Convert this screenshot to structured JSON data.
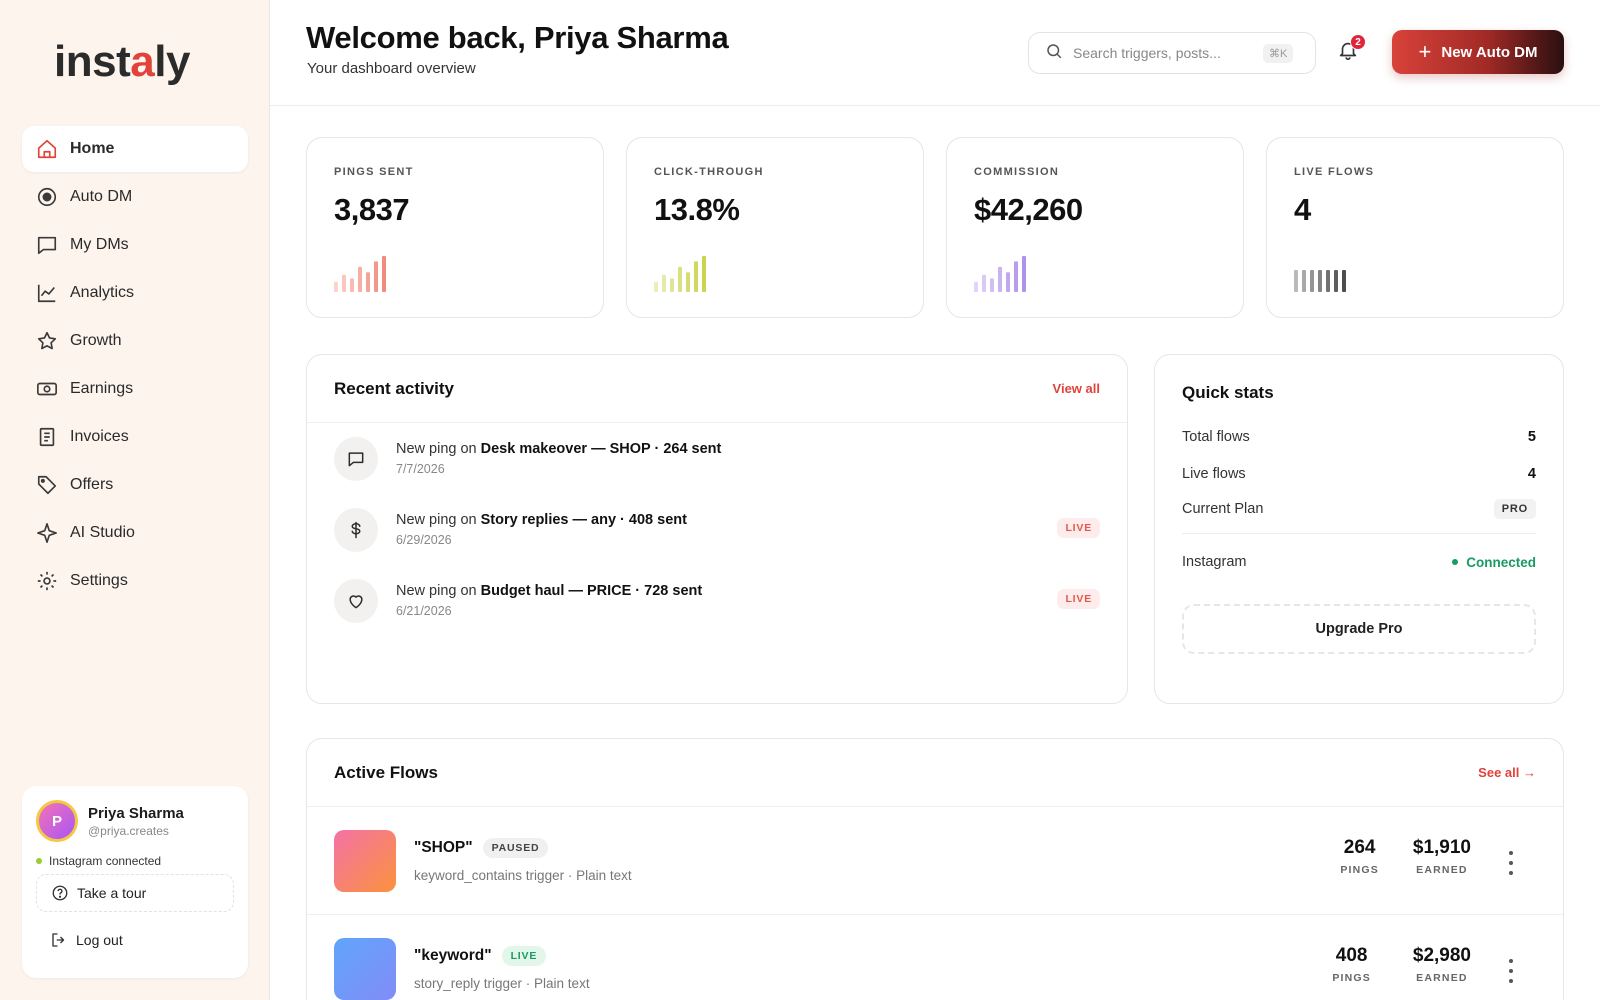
{
  "brand": {
    "logo_pre": "inst",
    "logo_dot": "a",
    "logo_post": "ly",
    "accent": "#e0433a"
  },
  "sidebar": {
    "items": [
      {
        "label": "Home",
        "icon": "home-icon",
        "active": true
      },
      {
        "label": "Auto DM",
        "icon": "radio-target-icon"
      },
      {
        "label": "My DMs",
        "icon": "message-square-icon"
      },
      {
        "label": "Analytics",
        "icon": "line-chart-icon"
      },
      {
        "label": "Growth",
        "icon": "star-icon"
      },
      {
        "label": "Earnings",
        "icon": "banknote-icon"
      },
      {
        "label": "Invoices",
        "icon": "receipt-icon"
      },
      {
        "label": "Offers",
        "icon": "tag-icon"
      },
      {
        "label": "AI Studio",
        "icon": "sparkle-icon"
      },
      {
        "label": "Settings",
        "icon": "gear-icon"
      }
    ],
    "user": {
      "initial": "P",
      "name": "Priya Sharma",
      "handle": "@priya.creates",
      "ig_status": "Instagram connected",
      "tour_label": "Take a tour",
      "logout_label": "Log out"
    }
  },
  "header": {
    "title": "Welcome back, Priya Sharma",
    "subtitle": "Your dashboard overview",
    "search_placeholder": "Search triggers, posts...",
    "search_shortcut": "⌘K",
    "notifications_count": "2",
    "new_button_label": "New Auto DM"
  },
  "stats": [
    {
      "label": "PINGS SENT",
      "value": "3,837",
      "color": "#f08070"
    },
    {
      "label": "CLICK-THROUGH",
      "value": "13.8%",
      "color": "#c5cf3a"
    },
    {
      "label": "COMMISSION",
      "value": "$42,260",
      "color": "#a987e8"
    },
    {
      "label": "LIVE FLOWS",
      "value": "4",
      "color": "#3a3a3a"
    }
  ],
  "recent": {
    "title": "Recent activity",
    "view_all": "View all",
    "items": [
      {
        "prefix": "New ping on ",
        "name": "Desk makeover — SHOP · 264 sent",
        "date": "7/7/2026",
        "icon": "message-icon",
        "badge": ""
      },
      {
        "prefix": "New ping on ",
        "name": "Story replies — any · 408 sent",
        "date": "6/29/2026",
        "icon": "dollar-icon",
        "badge": "LIVE"
      },
      {
        "prefix": "New ping on ",
        "name": "Budget haul — PRICE · 728 sent",
        "date": "6/21/2026",
        "icon": "heart-icon",
        "badge": "LIVE"
      }
    ]
  },
  "quick": {
    "title": "Quick stats",
    "total_flows_label": "Total flows",
    "total_flows_value": "5",
    "live_flows_label": "Live flows",
    "live_flows_value": "4",
    "plan_label": "Current Plan",
    "plan_value": "PRO",
    "instagram_label": "Instagram",
    "instagram_value": "Connected",
    "upgrade_label": "Upgrade Pro"
  },
  "flows": {
    "title": "Active Flows",
    "see_all": "See all",
    "items": [
      {
        "name": "\"SHOP\"",
        "status": "PAUSED",
        "meta": "keyword_contains trigger · Plain text",
        "pings": "264",
        "pings_label": "PINGS",
        "earned": "$1,910",
        "earned_label": "EARNED",
        "gradient": [
          "#f472a6",
          "#fb923c"
        ]
      },
      {
        "name": "\"keyword\"",
        "status": "LIVE",
        "meta": "story_reply trigger · Plain text",
        "pings": "408",
        "pings_label": "PINGS",
        "earned": "$2,980",
        "earned_label": "EARNED",
        "gradient": [
          "#60a5fa",
          "#818cf8"
        ]
      }
    ]
  }
}
